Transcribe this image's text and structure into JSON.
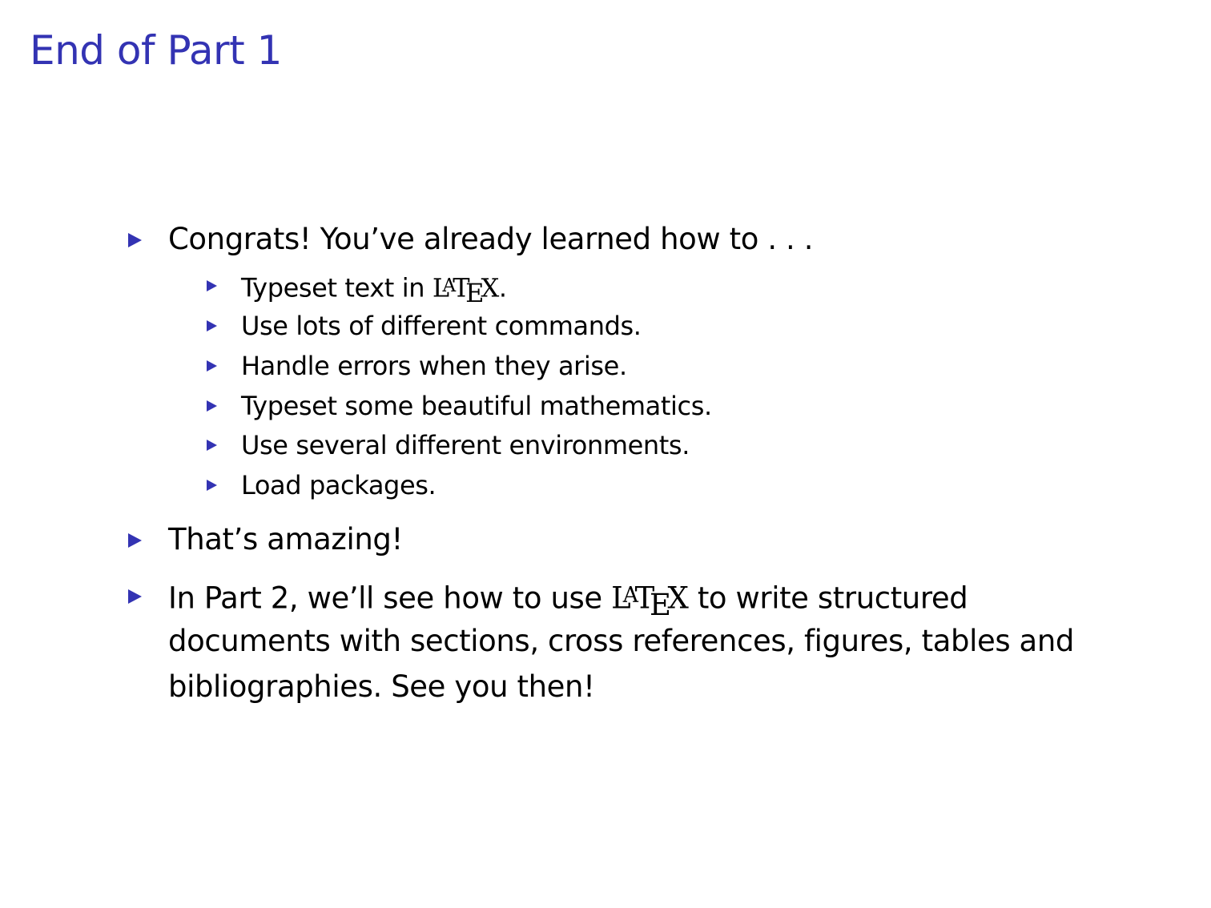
{
  "slide": {
    "title": "End of Part 1",
    "accent_color": "#3333b3",
    "bullet_icon": "triangle-bullet"
  },
  "items": [
    {
      "text": "Congrats! You’ve already learned how to . . .",
      "subitems": [
        {
          "before": "Typeset text in ",
          "logo": "LaTeX",
          "after": "."
        },
        {
          "text": "Use lots of different commands."
        },
        {
          "text": "Handle errors when they arise."
        },
        {
          "text": "Typeset some beautiful mathematics."
        },
        {
          "text": "Use several different environments."
        },
        {
          "text": "Load packages."
        }
      ]
    },
    {
      "text": "That’s amazing!"
    },
    {
      "before": "In Part 2, we’ll see how to use ",
      "logo": "LaTeX",
      "after": " to write structured",
      "line2": "documents with sections, cross references, figures, tables and",
      "line3": "bibliographies. See you then!"
    }
  ]
}
